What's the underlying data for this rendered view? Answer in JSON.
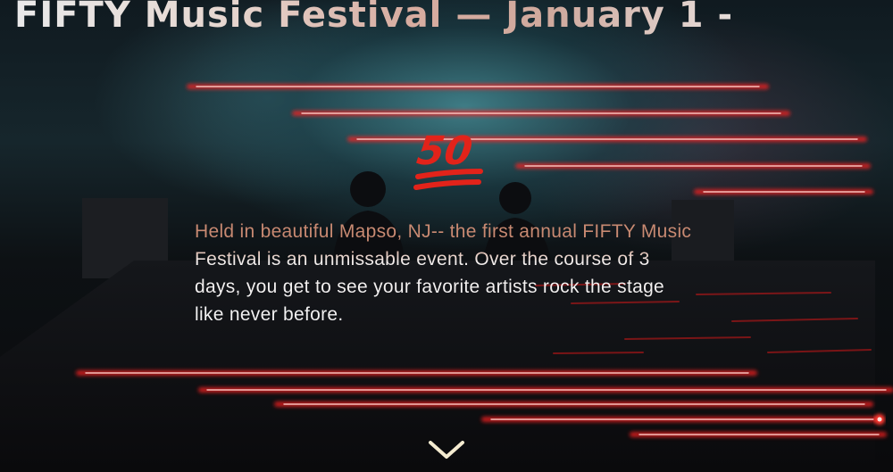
{
  "hero": {
    "headline": "FIFTY Music Festival — January 1 -",
    "badge": {
      "text": "50",
      "icon": "hundred-points-emoji-icon",
      "color": "#e2231a"
    },
    "intro": "Held in beautiful Mapso, NJ-- the first annual FIFTY Music Festival is an unmissable event. Over the course of 3 days, you get to see your favorite artists rock the stage like never before.",
    "scroll_icon": "chevron-down-icon",
    "accent_color": "#ff2a2a"
  }
}
